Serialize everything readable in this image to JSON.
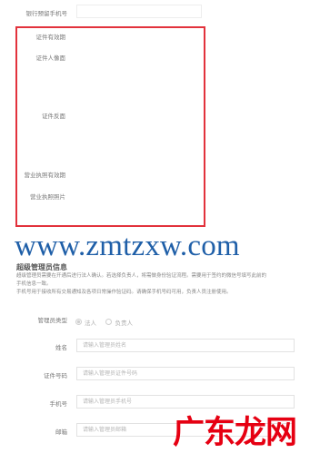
{
  "top_field": {
    "label": "银行预留手机号",
    "value": ""
  },
  "highlighted_section": {
    "labels": [
      "证件有效期",
      "证件人像面",
      "证件反面",
      "营业执照有效期",
      "营业执照照片"
    ]
  },
  "watermark": "www.zmtzxw.com",
  "admin_section": {
    "title": "超级管理员信息",
    "desc_line1": "超级管理员需要在开通后进行法人确认。若选择负责人，将需做身份验证流程。需要用于签约的微信号填写此前的",
    "desc_line2": "手机信息一致。",
    "desc_line3": "手机号用于接收所有交易通知及各项日常操作验证码。请确保手机号码可用，负责人员注册使用。"
  },
  "form": {
    "type": {
      "label": "管理员类型",
      "options": [
        "法人",
        "负责人"
      ],
      "selected": 0
    },
    "name": {
      "label": "姓名",
      "placeholder": "请输入管理员姓名"
    },
    "id_number": {
      "label": "证件号码",
      "placeholder": "请输入管理员证件号码"
    },
    "phone": {
      "label": "手机号",
      "placeholder": "请输入管理员手机号"
    },
    "email": {
      "label": "邮箱",
      "placeholder": "请输入管理员邮箱"
    }
  },
  "brand_watermark": "广东龙网",
  "colors": {
    "highlight_border": "#e2323c",
    "watermark": "#1f5fa8",
    "brand": "#e60012"
  }
}
